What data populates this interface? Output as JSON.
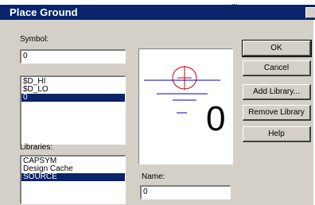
{
  "titlebar": {
    "dots": "...",
    "title": "Place Ground"
  },
  "symbol": {
    "label": "Symbol:",
    "value": "0"
  },
  "symbol_list": {
    "items": [
      "$D_HI",
      "$D_LO",
      "0"
    ],
    "selected_index": 2
  },
  "libraries": {
    "label": "Libraries:",
    "items": [
      "CAPSYM",
      "Design Cache",
      "SOURCE"
    ],
    "selected_index": 2
  },
  "preview": {
    "value_text": "0",
    "symbol_color": "#cc0000",
    "line_color": "#0000cc"
  },
  "name": {
    "label": "Name:",
    "value": "0"
  },
  "buttons": {
    "ok": "OK",
    "cancel": "Cancel",
    "add_library": "Add Library...",
    "remove_library": "Remove Library",
    "help": "Help"
  }
}
